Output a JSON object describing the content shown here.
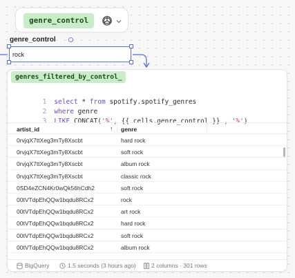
{
  "control_cell": {
    "name_tag": "genre_control",
    "ai_icon": "openai-icon",
    "ai_chevron_icon": "chevron-down-icon",
    "label": "genre_control",
    "input_value": "rock"
  },
  "sql_cell": {
    "name_tag": "genres_filtered_by_control_",
    "lines": [
      {
        "num": "1",
        "kw1": "select",
        "t1": " * ",
        "kw2": "from",
        "t2": " spotify.spotify_genres",
        "s": "",
        "t3": "",
        "s2": "",
        "t4": ""
      },
      {
        "num": "2",
        "kw1": "where",
        "t1": " genre",
        "kw2": "",
        "t2": "",
        "s": "",
        "t3": "",
        "s2": "",
        "t4": ""
      },
      {
        "num": "3",
        "kw1": "LIKE",
        "t1": " CONCAT(",
        "kw2": "",
        "t2": "",
        "s": "'%'",
        "t3": ", {{ cells.genre_control }} , ",
        "s2": "'%'",
        "t4": ")"
      }
    ]
  },
  "table": {
    "columns": [
      "artist_id",
      "genre"
    ],
    "sort_indicator": "↑",
    "rows": [
      [
        "0rvjqX7ttXeg3mTy8Xscbt",
        "hard rock"
      ],
      [
        "0rvjqX7ttXeg3mTy8Xscbt",
        "soft rock"
      ],
      [
        "0rvjqX7ttXeg3mTy8Xscbt",
        "album rock"
      ],
      [
        "0rvjqX7ttXeg3mTy8Xscbt",
        "classic rock"
      ],
      [
        "0SD4eZCN4Kr0wQk56hCdh2",
        "soft rock"
      ],
      [
        "00tVTdpEhQQw1bqdu8RCx2",
        "rock"
      ],
      [
        "00tVTdpEhQQw1bqdu8RCx2",
        "art rock"
      ],
      [
        "00tVTdpEhQQw1bqdu8RCx2",
        "hard rock"
      ],
      [
        "00tVTdpEhQQw1bqdu8RCx2",
        "soft rock"
      ],
      [
        "00tVTdpEhQQw1bqdu8RCx2",
        "album rock"
      ]
    ]
  },
  "footer": {
    "source": "BigQuery",
    "source_icon": "database-icon",
    "timing": "1.5 seconds (3 hours ago)",
    "timing_icon": "clock-icon",
    "summary": "2 columns · 301 rows",
    "summary_icon": "columns-icon"
  },
  "colors": {
    "tag_bg": "#c9ecc9",
    "selection": "#5a6fd6",
    "keyword": "#6a4bc4",
    "string": "#c0433f"
  }
}
